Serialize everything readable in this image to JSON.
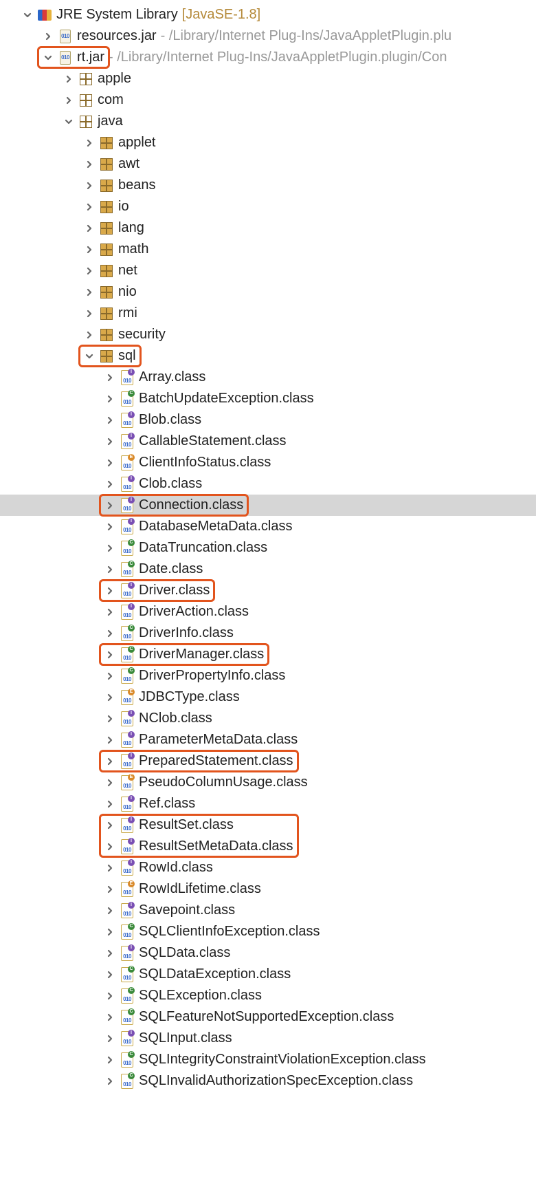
{
  "root": {
    "label": "JRE System Library",
    "bracket": "[JavaSE-1.8]"
  },
  "jars": [
    {
      "label": "resources.jar",
      "path": " - /Library/Internet Plug-Ins/JavaAppletPlugin.plu",
      "expanded": false
    },
    {
      "label": "rt.jar",
      "path": " - /Library/Internet Plug-Ins/JavaAppletPlugin.plugin/Con",
      "expanded": true
    }
  ],
  "rt_packages": [
    {
      "label": "apple",
      "expanded": false
    },
    {
      "label": "com",
      "expanded": false
    },
    {
      "label": "java",
      "expanded": true
    }
  ],
  "java_packages": [
    {
      "label": "applet"
    },
    {
      "label": "awt"
    },
    {
      "label": "beans"
    },
    {
      "label": "io"
    },
    {
      "label": "lang"
    },
    {
      "label": "math"
    },
    {
      "label": "net"
    },
    {
      "label": "nio"
    },
    {
      "label": "rmi"
    },
    {
      "label": "security"
    },
    {
      "label": "sql",
      "expanded": true
    }
  ],
  "sql_classes": [
    {
      "label": "Array.class",
      "k": "i"
    },
    {
      "label": "BatchUpdateException.class",
      "k": "c"
    },
    {
      "label": "Blob.class",
      "k": "i"
    },
    {
      "label": "CallableStatement.class",
      "k": "i"
    },
    {
      "label": "ClientInfoStatus.class",
      "k": "e"
    },
    {
      "label": "Clob.class",
      "k": "i"
    },
    {
      "label": "Connection.class",
      "k": "i",
      "selected": true
    },
    {
      "label": "DatabaseMetaData.class",
      "k": "i"
    },
    {
      "label": "DataTruncation.class",
      "k": "c"
    },
    {
      "label": "Date.class",
      "k": "c"
    },
    {
      "label": "Driver.class",
      "k": "i"
    },
    {
      "label": "DriverAction.class",
      "k": "i"
    },
    {
      "label": "DriverInfo.class",
      "k": "c"
    },
    {
      "label": "DriverManager.class",
      "k": "c"
    },
    {
      "label": "DriverPropertyInfo.class",
      "k": "c"
    },
    {
      "label": "JDBCType.class",
      "k": "e"
    },
    {
      "label": "NClob.class",
      "k": "i"
    },
    {
      "label": "ParameterMetaData.class",
      "k": "i"
    },
    {
      "label": "PreparedStatement.class",
      "k": "i"
    },
    {
      "label": "PseudoColumnUsage.class",
      "k": "e"
    },
    {
      "label": "Ref.class",
      "k": "i"
    },
    {
      "label": "ResultSet.class",
      "k": "i"
    },
    {
      "label": "ResultSetMetaData.class",
      "k": "i"
    },
    {
      "label": "RowId.class",
      "k": "i"
    },
    {
      "label": "RowIdLifetime.class",
      "k": "e"
    },
    {
      "label": "Savepoint.class",
      "k": "i"
    },
    {
      "label": "SQLClientInfoException.class",
      "k": "c"
    },
    {
      "label": "SQLData.class",
      "k": "i"
    },
    {
      "label": "SQLDataException.class",
      "k": "c"
    },
    {
      "label": "SQLException.class",
      "k": "c"
    },
    {
      "label": "SQLFeatureNotSupportedException.class",
      "k": "c"
    },
    {
      "label": "SQLInput.class",
      "k": "i"
    },
    {
      "label": "SQLIntegrityConstraintViolationException.class",
      "k": "c"
    },
    {
      "label": "SQLInvalidAuthorizationSpecException.class",
      "k": "c"
    }
  ],
  "highlights": [
    {
      "targets": [
        "rt.jar"
      ]
    },
    {
      "targets": [
        "sql"
      ]
    },
    {
      "targets": [
        "Connection.class"
      ]
    },
    {
      "targets": [
        "Driver.class"
      ]
    },
    {
      "targets": [
        "DriverManager.class"
      ]
    },
    {
      "targets": [
        "PreparedStatement.class"
      ]
    },
    {
      "targets": [
        "ResultSet.class",
        "ResultSetMetaData.class"
      ]
    }
  ]
}
